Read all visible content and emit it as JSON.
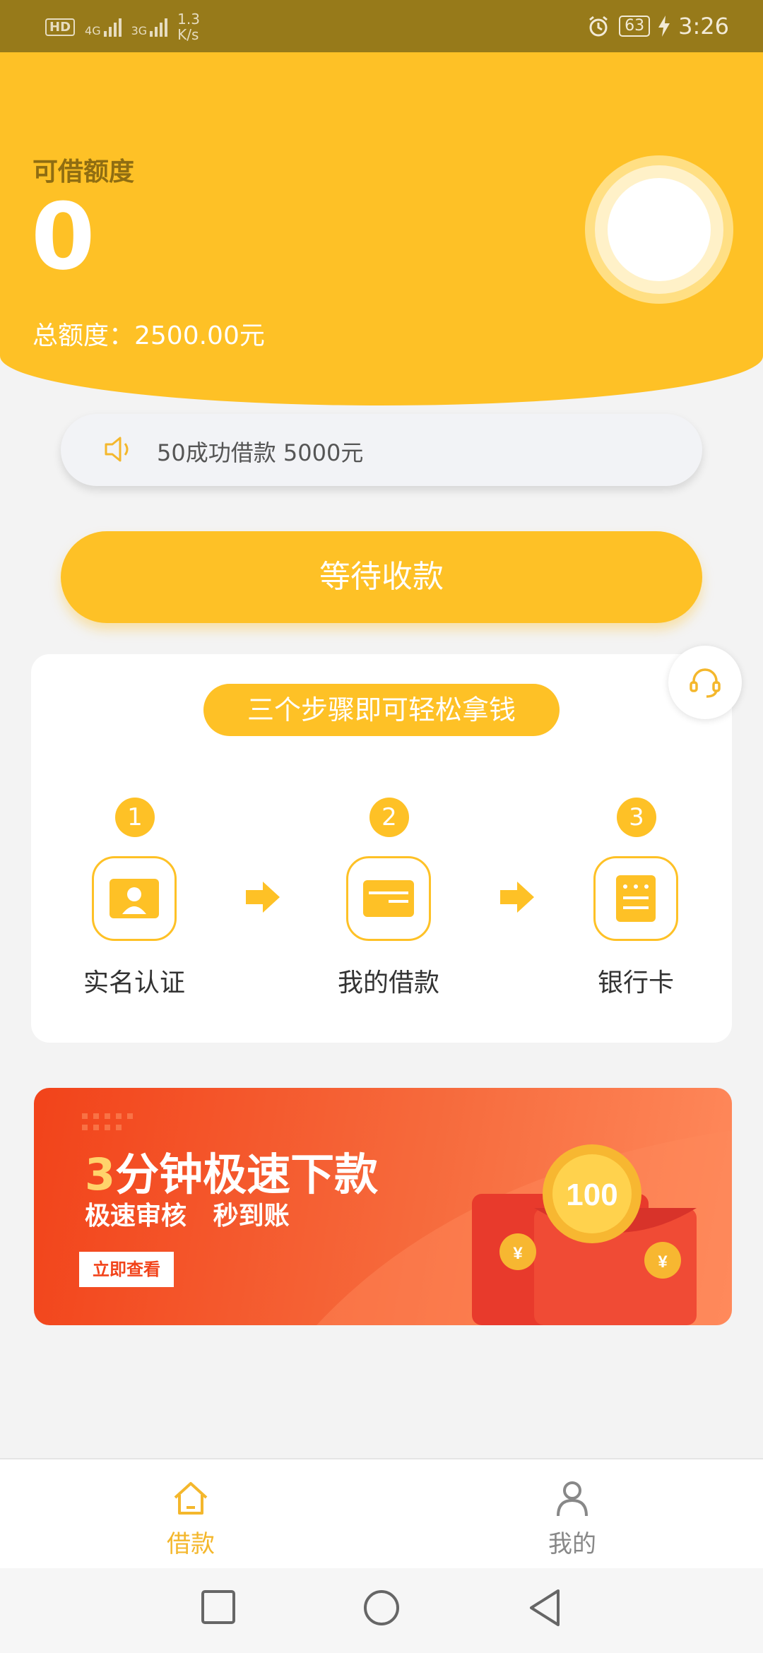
{
  "status_bar": {
    "network_hd": "HD",
    "sig1_type": "4G",
    "sig2_type": "3G",
    "speed": "1.3",
    "speed_unit": "K/s",
    "battery": "63",
    "time": "3:26",
    "icons": [
      "alarm-icon",
      "charging-icon"
    ]
  },
  "header": {
    "credit_label": "可借额度",
    "credit_value": "0",
    "total_label": "总额度：2500.00元"
  },
  "notice": {
    "text": "50成功借款 5000元",
    "icon": "speaker-icon"
  },
  "main_button": {
    "label": "等待收款"
  },
  "steps": {
    "title": "三个步骤即可轻松拿钱",
    "items": [
      {
        "num": "1",
        "label": "实名认证",
        "icon": "id-card-icon"
      },
      {
        "num": "2",
        "label": "我的借款",
        "icon": "card-icon"
      },
      {
        "num": "3",
        "label": "银行卡",
        "icon": "document-icon"
      }
    ]
  },
  "banner": {
    "title_first": "3",
    "title_rest": "分钟极速下款",
    "subtitle": "极速审核   秒到账",
    "button": "立即查看",
    "coin_text": "100",
    "yen": "¥"
  },
  "bottom_nav": {
    "items": [
      {
        "label": "借款",
        "icon": "home-icon",
        "active": true
      },
      {
        "label": "我的",
        "icon": "user-icon",
        "active": false
      }
    ],
    "active_color": "#f4b72c",
    "inactive_color": "#888888"
  },
  "colors": {
    "accent": "#fec126",
    "banner": "#f2431a"
  }
}
